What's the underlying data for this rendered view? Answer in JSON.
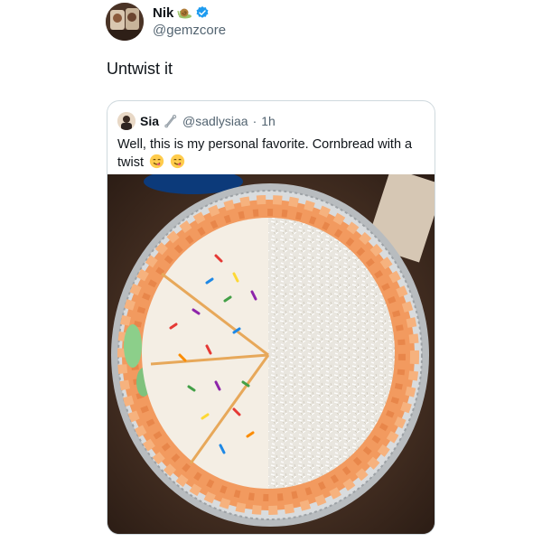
{
  "tweet": {
    "author_name": "Nik",
    "author_handle": "@gemzcore",
    "text": "Untwist it",
    "icons": [
      "avatar",
      "snail-emoji-icon",
      "verified-badge-icon"
    ]
  },
  "quote": {
    "author_name": "Sia",
    "author_handle": "@sadlysiaa",
    "separator": "·",
    "time": "1h",
    "text": "Well, this is my personal favorite. Cornbread with a twist",
    "emojis": [
      "yum-face-emoji",
      "yum-face-emoji"
    ],
    "image": "photo of a round frosted cornbread in a foil pan: half with white icing and rainbow sprinkles, half with shredded coconut, orange piped border"
  },
  "colors": {
    "text": "#0f1419",
    "secondary": "#536471",
    "border": "#cfd9de",
    "verified": "#1d9bf0"
  }
}
